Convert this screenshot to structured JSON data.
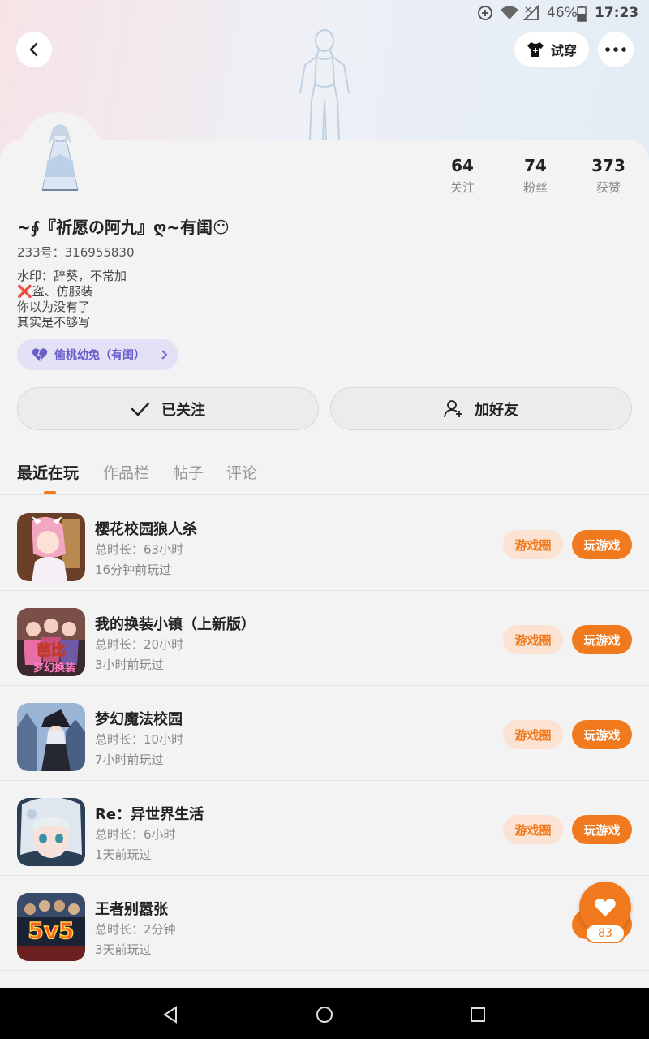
{
  "status_bar": {
    "battery": "46%",
    "time": "17:23"
  },
  "header": {
    "tryon_label": "试穿"
  },
  "stats": [
    {
      "value": "64",
      "label": "关注"
    },
    {
      "value": "74",
      "label": "粉丝"
    },
    {
      "value": "373",
      "label": "获赞"
    }
  ],
  "profile": {
    "nickname": "~∮『祈愿の阿九』ღ~有闺😶",
    "uid": "233号：316955830",
    "bio": [
      "水印：辞葵，不常加",
      "❌盗、仿服装",
      "你以为没有了",
      "其实是不够写"
    ],
    "club": "偷桃幼兔（有闺）"
  },
  "actions": {
    "following_label": "已关注",
    "add_friend_label": "加好友"
  },
  "tabs": [
    "最近在玩",
    "作品栏",
    "帖子",
    "评论"
  ],
  "games": [
    {
      "name": "樱花校园狼人杀",
      "duration": "总时长：63小时",
      "last_played": "16分钟前玩过"
    },
    {
      "name": "我的换装小镇（上新版）",
      "duration": "总时长：20小时",
      "last_played": "3小时前玩过",
      "icon_text": "芭比",
      "icon_sub": "梦幻换装"
    },
    {
      "name": "梦幻魔法校园",
      "duration": "总时长：10小时",
      "last_played": "7小时前玩过"
    },
    {
      "name": "Re：异世界生活",
      "duration": "总时长：6小时",
      "last_played": "1天前玩过"
    },
    {
      "name": "王者别嚣张",
      "duration": "总时长：2分钟",
      "last_played": "3天前玩过",
      "icon_text": "5v5"
    }
  ],
  "game_buttons": {
    "circle": "游戏圈",
    "play": "玩游戏"
  },
  "fab": {
    "count": "83"
  },
  "colors": {
    "accent": "#f07a1d",
    "accent_light": "#fbe2d3",
    "club_purple": "#6a5cc9"
  }
}
